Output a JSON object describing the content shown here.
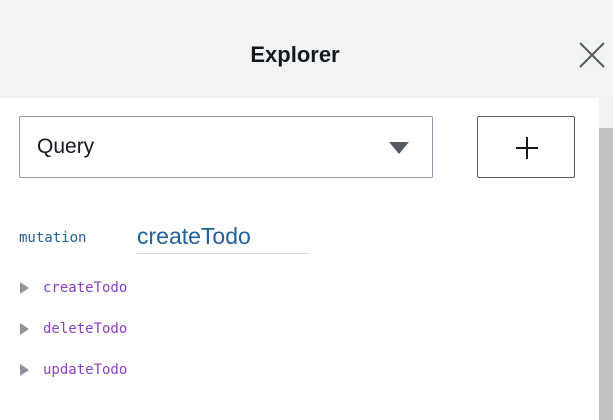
{
  "header": {
    "title": "Explorer",
    "close_icon": "close-icon"
  },
  "operation_select": {
    "value": "Query",
    "icon": "caret-down-icon"
  },
  "add_button": {
    "icon": "plus-icon"
  },
  "operation": {
    "type": "mutation",
    "name": "createTodo"
  },
  "fields": [
    {
      "label": "createTodo",
      "icon": "expand-arrow-icon"
    },
    {
      "label": "deleteTodo",
      "icon": "expand-arrow-icon"
    },
    {
      "label": "updateTodo",
      "icon": "expand-arrow-icon"
    }
  ],
  "colors": {
    "header_bg": "#f2f3f3",
    "operation_name": "#1f61a0",
    "field_label": "#8b3fc9",
    "border": "#8d99a8"
  }
}
